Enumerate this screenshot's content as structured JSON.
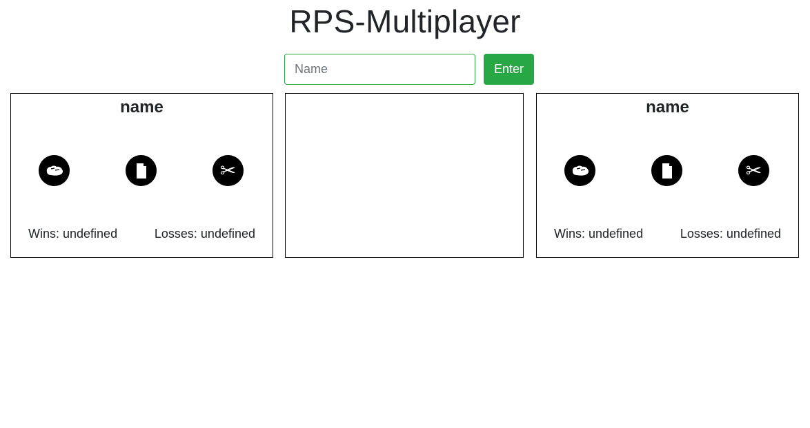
{
  "page": {
    "title": "RPS-Multiplayer"
  },
  "form": {
    "name_placeholder": "Name",
    "name_value": "",
    "enter_label": "Enter"
  },
  "players": [
    {
      "name": "name",
      "wins": "Wins: undefined",
      "losses": "Losses: undefined",
      "choices": [
        "rock-icon",
        "paper-icon",
        "scissors-icon"
      ]
    },
    {
      "name": "name",
      "wins": "Wins: undefined",
      "losses": "Losses: undefined",
      "choices": [
        "rock-icon",
        "paper-icon",
        "scissors-icon"
      ]
    }
  ],
  "colors": {
    "accent": "#28a745",
    "text": "#212529",
    "border": "#000000"
  }
}
